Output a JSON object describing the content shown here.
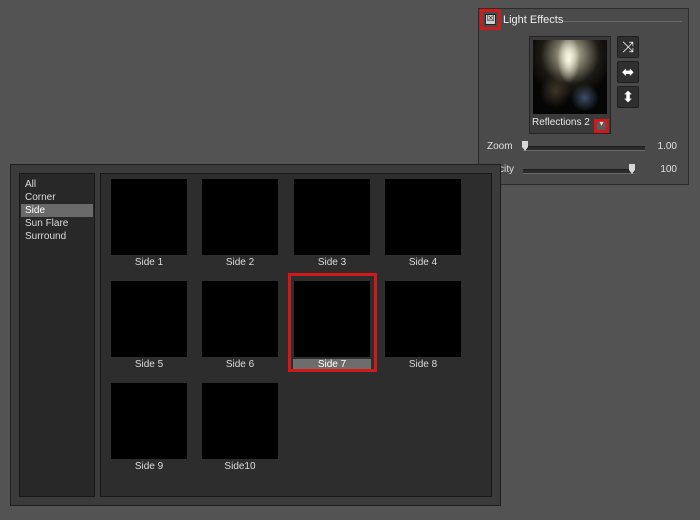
{
  "light_effects": {
    "checkbox_mark": "☒",
    "title": "Light Effects",
    "preset_name": "Reflections 2",
    "buttons": [
      {
        "icon": "shuffle-icon",
        "glyph": "⤨"
      },
      {
        "icon": "flip-horizontal-icon",
        "glyph": "⬌"
      },
      {
        "icon": "flip-vertical-icon",
        "glyph": "⬍"
      }
    ],
    "zoom": {
      "label": "Zoom",
      "value": "1.00",
      "level": 0.0
    },
    "opacity": {
      "label": "city",
      "value": "100",
      "level": 1.0
    }
  },
  "browser": {
    "categories": [
      "All",
      "Corner",
      "Side",
      "Sun Flare",
      "Surround"
    ],
    "selected_category": "Side",
    "presets": [
      "Side 1",
      "Side 2",
      "Side 3",
      "Side 4",
      "Side 5",
      "Side 6",
      "Side 7",
      "Side 8",
      "Side 9",
      "Side10"
    ],
    "selected_preset": "Side 7"
  },
  "colors": {
    "highlight": "#d01a1a",
    "background": "#535353"
  }
}
